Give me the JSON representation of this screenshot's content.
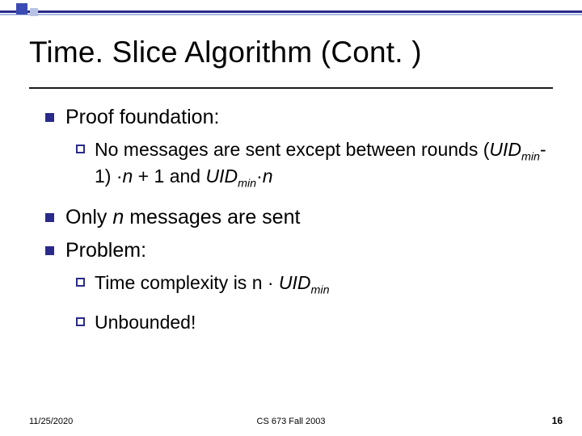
{
  "title": "Time. Slice Algorithm (Cont. )",
  "bullets": {
    "proof_label": "Proof foundation:",
    "proof_sub_prefix": "No",
    "proof_sub_body_a": " messages are sent except between rounds (",
    "proof_sub_uid": "UID",
    "proof_sub_min": "min",
    "proof_sub_body_b": "-1) ·",
    "proof_sub_n1": "n",
    "proof_sub_body_c": " + 1 and ",
    "proof_sub_body_d": "·",
    "proof_sub_n2": "n",
    "only_a": "Only ",
    "only_n": "n",
    "only_b": " messages are sent",
    "problem_label": "Problem:",
    "time_prefix": "Time",
    "time_body_a": " complexity is n · ",
    "time_uid": "UID",
    "time_min": "min",
    "unbounded_prefix": "Unbounded",
    "unbounded_body": "!"
  },
  "footer": {
    "date": "11/25/2020",
    "course": "CS 673 Fall 2003",
    "page": "16"
  }
}
